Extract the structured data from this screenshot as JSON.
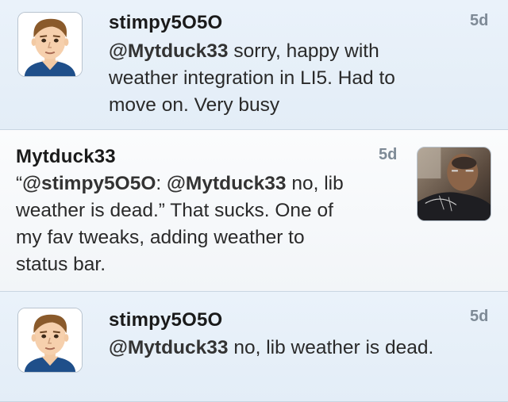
{
  "tweets": [
    {
      "username": "stimpy5O5O",
      "time": "5d",
      "mention": "@Mytduck33",
      "text_line1": " sorry, happy with",
      "text_line2": "weather integration in LI5. Had to",
      "text_line3": "move on.  Very busy"
    },
    {
      "username": "Mytduck33",
      "time": "5d",
      "quote_open": "“",
      "mention1": "@stimpy5O5O",
      "sep": ": ",
      "mention2": "@Mytduck33",
      "text_line1": " no, lib",
      "text_line2": "weather is dead.” That sucks. One of",
      "text_line3": "my fav tweaks, adding weather to",
      "text_line4": "status bar."
    },
    {
      "username": "stimpy5O5O",
      "time": "5d",
      "mention": "@Mytduck33",
      "text_line1": " no, lib weather is dead."
    }
  ]
}
